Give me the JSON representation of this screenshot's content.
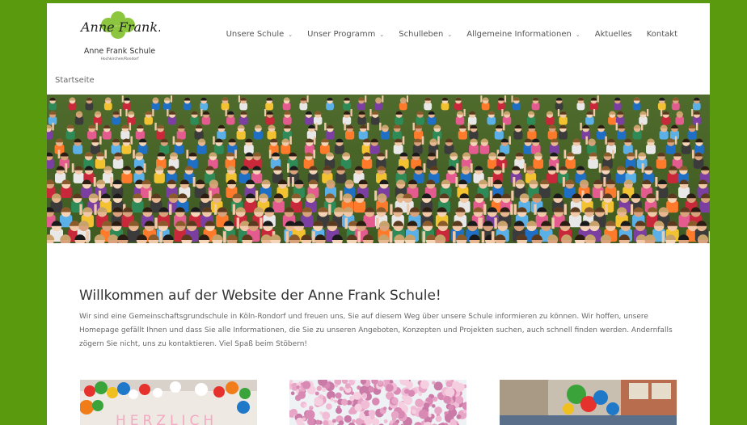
{
  "brand": {
    "script": "Anne Frank.",
    "name": "Anne Frank Schule",
    "subtitle": "Hochkirchen/Rondorf"
  },
  "nav": [
    {
      "label": "Unsere Schule",
      "dropdown": true
    },
    {
      "label": "Unser Programm",
      "dropdown": true
    },
    {
      "label": "Schulleben",
      "dropdown": true
    },
    {
      "label": "Allgemeine Informationen",
      "dropdown": true
    },
    {
      "label": "Aktuelles",
      "dropdown": false
    },
    {
      "label": "Kontakt",
      "dropdown": false
    }
  ],
  "breadcrumb": "Startseite",
  "main": {
    "title": "Willkommen auf der Website der Anne Frank Schule!",
    "intro": "Wir sind eine Gemeinschaftsgrundschule in Köln-Rondorf und freuen uns, Sie auf diesem Weg über unsere Schule informieren zu können. Wir hoffen, unsere Homepage gefällt Ihnen und dass Sie alle Informationen, die Sie zu unseren Angeboten, Konzepten und Projekten suchen, auch schnell finden werden. Andernfalls zögern Sie nicht, uns zu kontaktieren. Viel Spaß beim Stöbern!"
  },
  "tiles": [
    {
      "sign": "HERZLICH"
    }
  ],
  "colors": {
    "frame": "#5a9a0e",
    "nav_text": "#555555",
    "heading": "#333333",
    "body_text": "#666666"
  }
}
